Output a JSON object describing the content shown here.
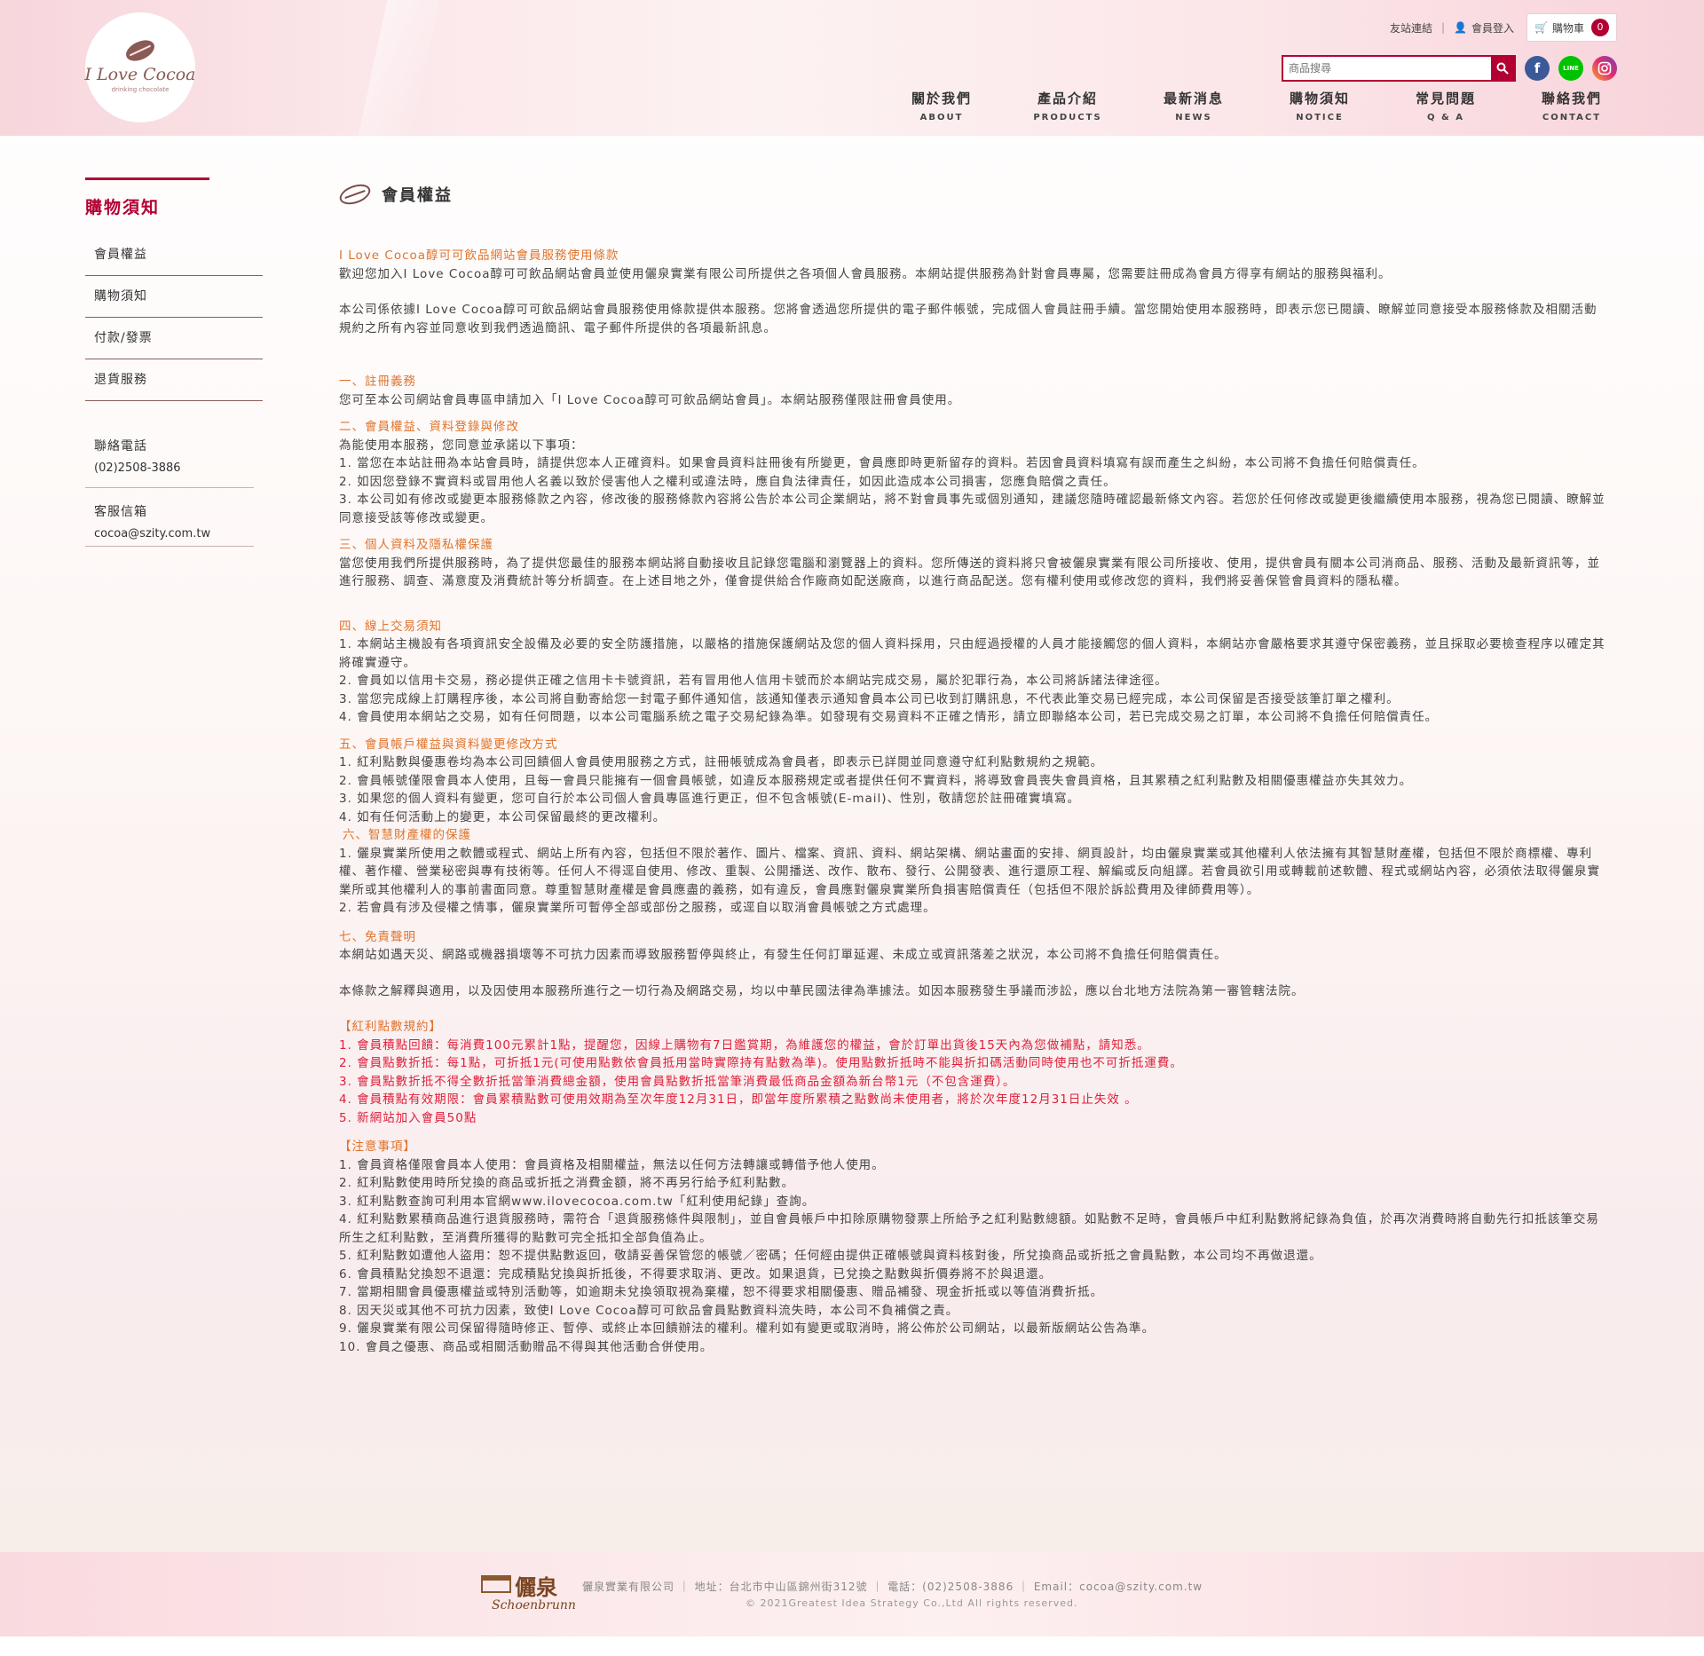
{
  "header": {
    "logo": {
      "name": "I Love Cocoa",
      "sub": "drinking chocolate"
    },
    "toplinks": {
      "friend": "友站連結",
      "login": "會員登入",
      "cart": "購物車",
      "cart_count": "0"
    },
    "search": {
      "placeholder": "商品搜尋"
    },
    "nav": [
      {
        "zh": "關於我們",
        "en": "ABOUT"
      },
      {
        "zh": "產品介紹",
        "en": "PRODUCTS"
      },
      {
        "zh": "最新消息",
        "en": "NEWS"
      },
      {
        "zh": "購物須知",
        "en": "NOTICE"
      },
      {
        "zh": "常見問題",
        "en": "Q & A"
      },
      {
        "zh": "聯絡我們",
        "en": "CONTACT"
      }
    ]
  },
  "sidebar": {
    "title": "購物須知",
    "items": [
      {
        "label": "會員權益"
      },
      {
        "label": "購物須知"
      },
      {
        "label": "付款/發票"
      },
      {
        "label": "退貨服務"
      }
    ],
    "contact": {
      "phone_label": "聯絡電話",
      "phone": "(02)2508-3886",
      "mail_label": "客服信箱",
      "mail": "cocoa@szity.com.tw"
    }
  },
  "main": {
    "title": "會員權益",
    "heading": "I Love Cocoa醇可可飲品網站會員服務使用條款",
    "intro1": "歡迎您加入I Love Cocoa醇可可飲品網站會員並使用儷泉實業有限公司所提供之各項個人會員服務。本網站提供服務為針對會員專屬，您需要註冊成為會員方得享有網站的服務與福利。",
    "intro2": "本公司係依據I Love Cocoa醇可可飲品網站會員服務使用條款提供本服務。您將會透過您所提供的電子郵件帳號，完成個人會員註冊手續。當您開始使用本服務時，即表示您已閱讀、瞭解並同意接受本服務條款及相關活動規約之所有內容並同意收到我們透過簡訊、電子郵件所提供的各項最新訊息。",
    "s1_title": "一、註冊義務",
    "s1_body": "您可至本公司網站會員專區申請加入「I Love Cocoa醇可可飲品網站會員」。本網站服務僅限註冊會員使用。",
    "s2_title": "二、會員權益、資料登錄與修改",
    "s2_lines": [
      "為能使用本服務，您同意並承諾以下事項：",
      "1. 當您在本站註冊為本站會員時，請提供您本人正確資料。如果會員資料註冊後有所變更，會員應即時更新留存的資料。若因會員資料填寫有誤而產生之糾紛，本公司將不負擔任何賠償責任。",
      "2. 如因您登錄不實資料或冒用他人名義以致於侵害他人之權利或違法時，應自負法律責任，如因此造成本公司損害，您應負賠償之責任。",
      "3. 本公司如有修改或變更本服務條款之內容，修改後的服務條款內容將公告於本公司企業網站，將不對會員事先或個別通知，建議您隨時確認最新條文內容。若您於任何修改或變更後繼續使用本服務，視為您已閱讀、瞭解並同意接受該等修改或變更。"
    ],
    "s3_title": "三、個人資料及隱私權保護",
    "s3_body": "當您使用我們所提供服務時，為了提供您最佳的服務本網站將自動接收且記錄您電腦和瀏覽器上的資料。您所傳送的資料將只會被儷泉實業有限公司所接收、使用，提供會員有關本公司消商品、服務、活動及最新資訊等，並進行服務、調查、滿意度及消費統計等分析調查。在上述目地之外，僅會提供給合作廠商如配送廠商，以進行商品配送。您有權利使用或修改您的資料，我們將妥善保管會員資料的隱私權。",
    "s4_title": "四、線上交易須知",
    "s4_lines": [
      "1. 本網站主機設有各項資訊安全設備及必要的安全防護措施，以嚴格的措施保護網站及您的個人資料採用，只由經過授權的人員才能接觸您的個人資料，本網站亦會嚴格要求其遵守保密義務，並且採取必要檢查程序以確定其將確實遵守。",
      "2. 會員如以信用卡交易，務必提供正確之信用卡卡號資訊，若有冒用他人信用卡號而於本網站完成交易，屬於犯罪行為，本公司將訴諸法律途徑。",
      "3. 當您完成線上訂購程序後，本公司將自動寄給您一封電子郵件通知信，該通知僅表示通知會員本公司已收到訂購訊息，不代表此筆交易已經完成，本公司保留是否接受該筆訂單之權利。",
      "4. 會員使用本網站之交易，如有任何問題，以本公司電腦系統之電子交易紀錄為準。如發現有交易資料不正確之情形，請立即聯絡本公司，若已完成交易之訂單，本公司將不負擔任何賠償責任。"
    ],
    "s5_title": "五、會員帳戶權益與資料變更修改方式",
    "s5_lines": [
      "1. 紅利點數與優惠卷均為本公司回饋個人會員使用服務之方式，註冊帳號成為會員者，即表示已詳閱並同意遵守紅利點數規約之規範。",
      "2. 會員帳號僅限會員本人使用，且每一會員只能擁有一個會員帳號，如違反本服務規定或者提供任何不實資料，將導致會員喪失會員資格，且其累積之紅利點數及相關優惠權益亦失其效力。",
      "3. 如果您的個人資料有變更，您可自行於本公司個人會員專區進行更正，但不包含帳號(E-mail)、性別，敬請您於註冊確實填寫。",
      "4. 如有任何活動上的變更，本公司保留最終的更改權利。"
    ],
    "s6_title": "六、智慧財產權的保護",
    "s6_lines": [
      "1. 儷泉實業所使用之軟體或程式、網站上所有內容，包括但不限於著作、圖片、檔案、資訊、資料、網站架構、網站畫面的安排、網頁設計，均由儷泉實業或其他權利人依法擁有其智慧財產權，包括但不限於商標權、專利權、著作權、營業秘密與專有技術等。任何人不得逕自使用、修改、重製、公開播送、改作、散布、發行、公開發表、進行還原工程、解編或反向組譯。若會員欲引用或轉載前述軟體、程式或網站內容，必須依法取得儷泉實業所或其他權利人的事前書面同意。尊重智慧財產權是會員應盡的義務，如有違反，會員應對儷泉實業所負損害賠償責任（包括但不限於訴訟費用及律師費用等）。",
      "2. 若會員有涉及侵權之情事，儷泉實業所可暫停全部或部份之服務，或逕自以取消會員帳號之方式處理。"
    ],
    "s7_title": "七、免責聲明",
    "s7_body": "本網站如遇天災、網路或機器損壞等不可抗力因素而導致服務暫停與終止，有發生任何訂單延遲、未成立或資訊落差之狀況，本公司將不負擔任何賠償責任。",
    "law": "本條款之解釋與適用，以及因使用本服務所進行之一切行為及網路交易，均以中華民國法律為準據法。如因本服務發生爭議而涉訟，應以台北地方法院為第一審管轄法院。",
    "bonus_title": "【紅利點數規約】",
    "bonus_lines": [
      "1. 會員積點回饋：每消費100元累計1點，提醒您，因線上購物有7日鑑賞期，為維護您的權益，會於訂單出貨後15天內為您做補點，請知悉。",
      "2. 會員點數折抵：每1點，可折抵1元(可使用點數依會員抵用當時實際持有點數為準)。使用點數折抵時不能與折扣碼活動同時使用也不可折抵運費。",
      "3. 會員點數折抵不得全數折抵當筆消費總金額，使用會員點數折抵當筆消費最低商品金額為新台幣1元（不包含運費）。",
      "4. 會員積點有效期限：會員累積點數可使用效期為至次年度12月31日，即當年度所累積之點數尚未使用者，將於次年度12月31日止失效 。",
      "5. 新網站加入會員50點"
    ],
    "notice_title": "【注意事項】",
    "notice_lines": [
      "1. 會員資格僅限會員本人使用：會員資格及相關權益，無法以任何方法轉讓或轉借予他人使用。",
      "2. 紅利點數使用時所兌換的商品或折抵之消費金額，將不再另行給予紅利點數。",
      "3. 紅利點數查詢可利用本官網www.ilovecocoa.com.tw「紅利使用紀錄」查詢。",
      "4. 紅利點數累積商品進行退貨服務時，需符合「退貨服務條件與限制」，並自會員帳戶中扣除原購物發票上所給予之紅利點數總額。如點數不足時，會員帳戶中紅利點數將紀錄為負值，於再次消費時將自動先行扣抵該筆交易所生之紅利點數，至消費所獲得的點數可完全抵扣全部負值為止。",
      "5. 紅利點數如遭他人盜用：恕不提供點數返回，敬請妥善保管您的帳號／密碼；任何經由提供正確帳號與資料核對後，所兌換商品或折抵之會員點數，本公司均不再做退還。",
      "6. 會員積點兌換恕不退還：完成積點兌換與折抵後，不得要求取消、更改。如果退貨，已兌換之點數與折價券將不於與退還。",
      "7. 當期相關會員優惠權益或特別活動等，如逾期未兌換領取視為棄權，恕不得要求相關優惠、贈品補發、現金折抵或以等值消費折抵。",
      "8. 因天災或其他不可抗力因素，致使I Love Cocoa醇可可飲品會員點數資料流失時，本公司不負補償之責。",
      "9. 儷泉實業有限公司保留得隨時修正、暫停、或終止本回饋辦法的權利。權利如有變更或取消時，將公佈於公司網站，以最新版網站公告為準。",
      "10. 會員之優惠、商品或相關活動贈品不得與其他活動合併使用。"
    ]
  },
  "footer": {
    "logo_cn": "儷泉",
    "logo_en": "Schoenbrunn",
    "info": "儷泉實業有限公司 ｜ 地址：台北市中山區錦州街312號 ｜ 電話：(02)2508-3886 ｜ Email：cocoa@szity.com.tw",
    "copyright": "© 2021Greatest Idea Strategy Co.,Ltd All rights reserved."
  },
  "colors": {
    "brand": "#b30033",
    "accent_orange": "#e0742c",
    "accent_red": "#e0203a",
    "cocoa": "#8c5a55"
  }
}
